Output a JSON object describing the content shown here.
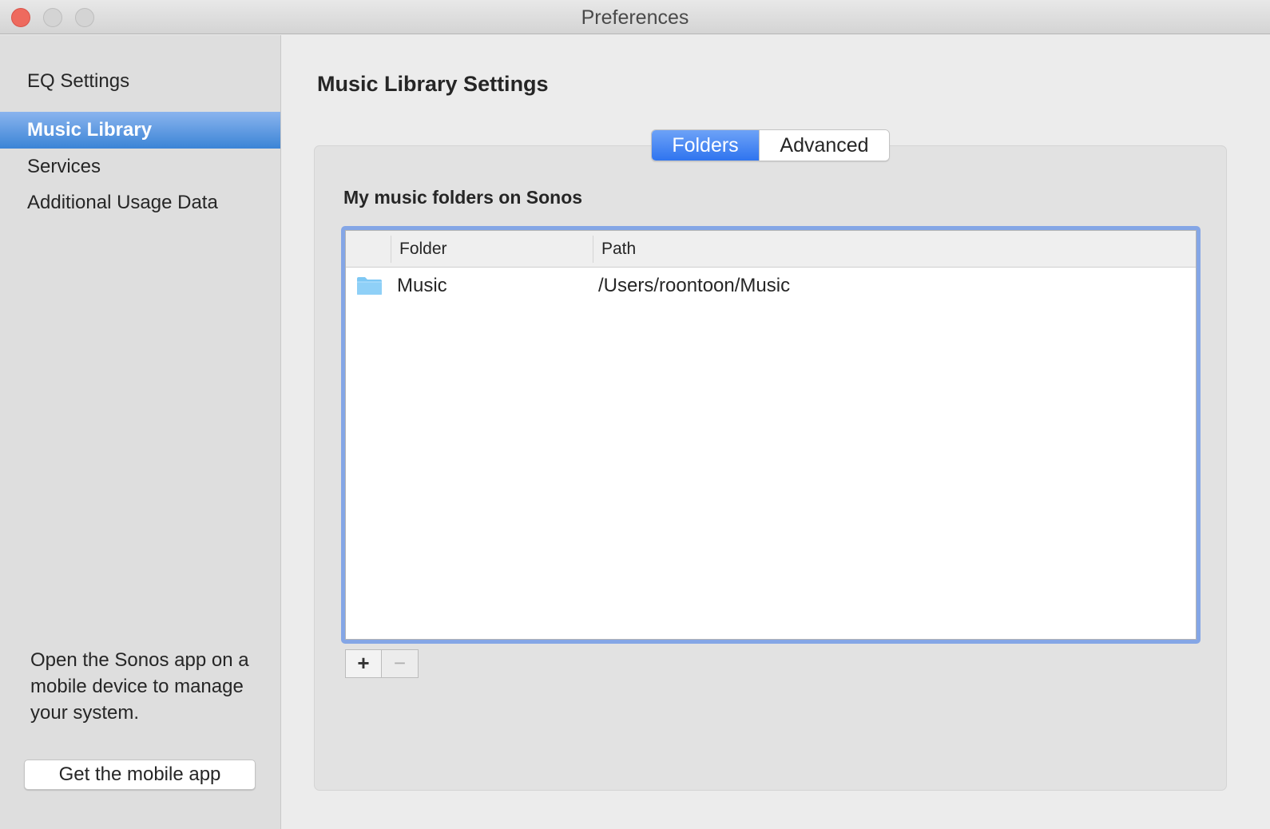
{
  "window": {
    "title": "Preferences"
  },
  "sidebar": {
    "items": [
      {
        "label": "EQ Settings",
        "selected": false
      },
      {
        "label": "Music Library",
        "selected": true
      },
      {
        "label": "Services",
        "selected": false
      },
      {
        "label": "Additional Usage Data",
        "selected": false
      }
    ],
    "note": "Open the Sonos app on a mobile device to manage your system.",
    "mobile_button_label": "Get the mobile app"
  },
  "main": {
    "title": "Music Library Settings",
    "tabs": [
      {
        "label": "Folders",
        "active": true
      },
      {
        "label": "Advanced",
        "active": false
      }
    ],
    "section_label": "My music folders on Sonos",
    "table": {
      "columns": [
        "",
        "Folder",
        "Path"
      ],
      "rows": [
        {
          "icon": "folder-icon",
          "folder": "Music",
          "path": "/Users/roontoon/Music"
        }
      ]
    },
    "add_button_label": "+",
    "remove_button_label": "−"
  },
  "colors": {
    "accent": "#3b84d6",
    "tab_active": "#2f74ef",
    "focus_ring": "#84a6e6",
    "close_button": "#ee6a5e",
    "folder_icon": "#7ec8f4"
  }
}
